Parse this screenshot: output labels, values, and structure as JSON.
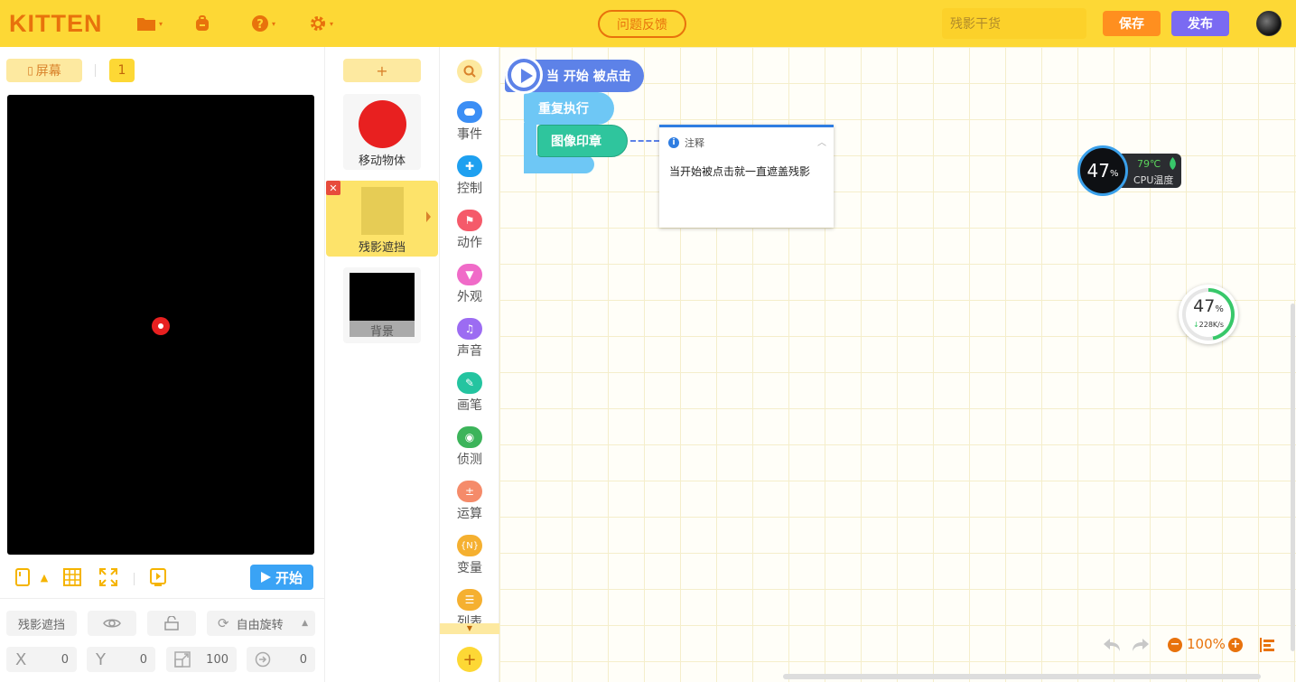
{
  "app": {
    "logo": "KITTEN",
    "feedback": "问题反馈",
    "project_name_placeholder": "残影干货",
    "save": "保存",
    "publish": "发布"
  },
  "stage": {
    "screen_label": "屏幕",
    "screen_number": "1",
    "start": "开始"
  },
  "properties": {
    "sprite_name": "残影遮挡",
    "rotation_mode": "自由旋转",
    "x_label": "X",
    "x": "0",
    "y_label": "Y",
    "y": "0",
    "size": "100",
    "direction": "0"
  },
  "sprites": {
    "add": "+",
    "items": [
      "移动物体",
      "残影遮挡",
      "背景"
    ]
  },
  "categories": [
    "事件",
    "控制",
    "动作",
    "外观",
    "声音",
    "画笔",
    "侦测",
    "运算",
    "变量",
    "列表"
  ],
  "script": {
    "hat": "当 开始 被点击",
    "repeat": "重复执行",
    "stamp": "图像印章"
  },
  "comment": {
    "title": "注释",
    "text": "当开始被点击就一直遮盖残影"
  },
  "cpu_widget": {
    "percent": "47",
    "percent_sign": "%",
    "temp": "79℃",
    "label": "CPU温度"
  },
  "net_widget": {
    "percent": "47",
    "percent_sign": "%",
    "speed": "228K/s"
  },
  "zoom": {
    "value": "100%"
  },
  "colors": {
    "topbar": "#fdd835",
    "accent": "#e8720c",
    "save": "#ff8f1f",
    "publish": "#7a6af2",
    "start": "#3aa3f5"
  }
}
